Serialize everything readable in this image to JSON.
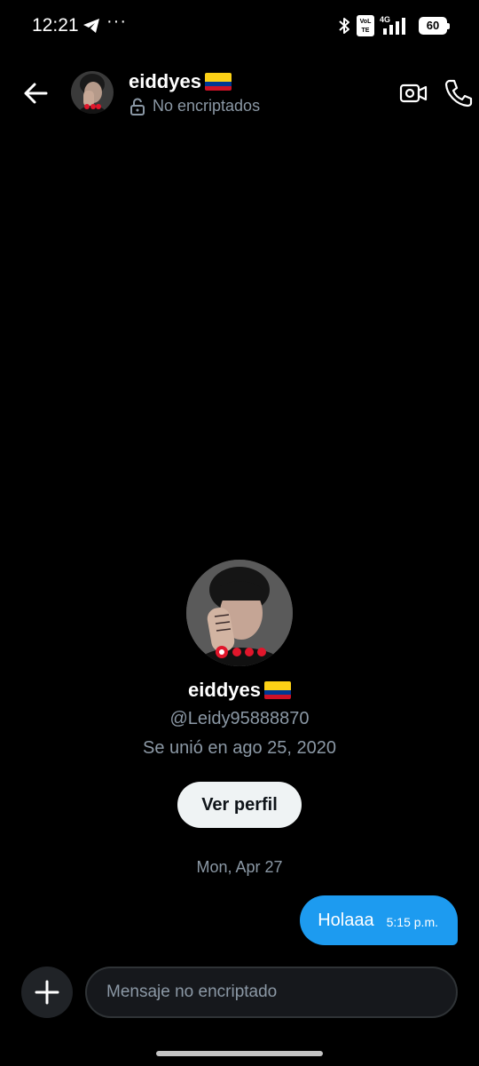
{
  "status_bar": {
    "time": "12:21",
    "dots": "···",
    "network_label": "4G",
    "volte_label": "VoLTE",
    "battery": "60",
    "icons": [
      "telegram-icon",
      "bluetooth-icon",
      "volte-icon",
      "signal-icon",
      "battery-icon"
    ]
  },
  "header": {
    "name": "eiddyes",
    "subtitle": "No encriptados",
    "icons": [
      "back-arrow-icon",
      "lock-open-icon",
      "video-call-icon",
      "phone-icon"
    ]
  },
  "profile": {
    "name": "eiddyes",
    "handle": "@Leidy95888870",
    "joined": "Se unió en ago 25, 2020",
    "button_label": "Ver perfil"
  },
  "conversation": {
    "date": "Mon, Apr 27",
    "messages": [
      {
        "text": "Holaaa",
        "time": "5:15 p.m.",
        "direction": "outgoing"
      }
    ]
  },
  "composer": {
    "placeholder": "Mensaje no encriptado",
    "value": ""
  },
  "colors": {
    "background": "#000000",
    "accent": "#1d9bf0",
    "secondary_text": "#8b98a5",
    "button_bg": "#eff3f4"
  }
}
